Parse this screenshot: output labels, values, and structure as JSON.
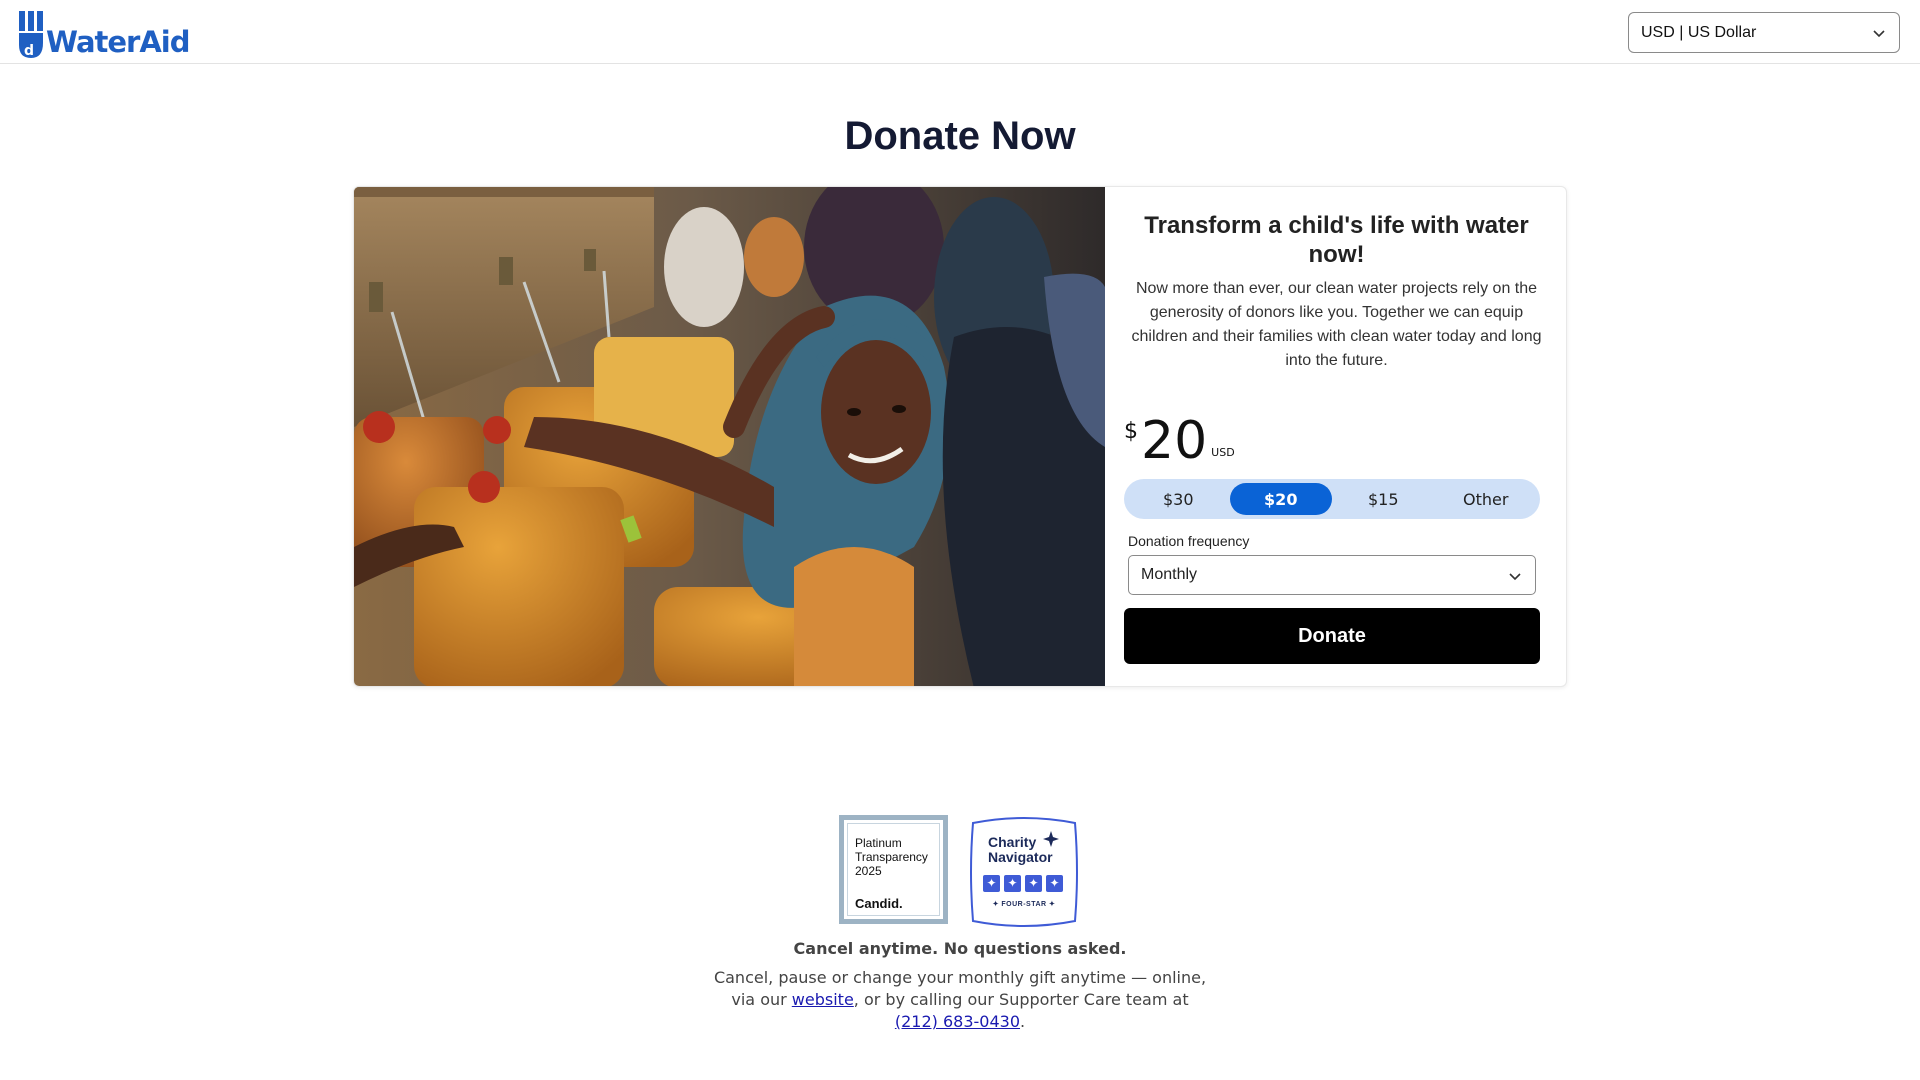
{
  "header": {
    "logo_text": "WaterAid",
    "currency_select_value": "USD | US Dollar",
    "brand_color": "#1f5fc2"
  },
  "page_title": "Donate Now",
  "photo": {
    "icon": "photo-children-water-taps"
  },
  "donation_panel": {
    "title": "Transform a child's life with water now!",
    "description": "Now more than ever, our clean water projects rely on the generosity of donors like you. Together we can equip children and their families with clean water today and long into the future.",
    "amount": {
      "currency_symbol": "$",
      "value": "20",
      "currency_code": "USD"
    },
    "amount_options": [
      {
        "label": "$30",
        "selected": false
      },
      {
        "label": "$20",
        "selected": true
      },
      {
        "label": "$15",
        "selected": false
      },
      {
        "label": "Other",
        "selected": false
      }
    ],
    "frequency_label": "Donation frequency",
    "frequency_value": "Monthly",
    "donate_button": "Donate",
    "accent_color": "#0a63d6"
  },
  "badges": {
    "candid": {
      "line1": "Platinum",
      "line2": "Transparency",
      "line3": "2025",
      "brand": "Candid."
    },
    "charity_navigator": {
      "line1": "Charity",
      "line2": "Navigator",
      "rating_label": "FOUR-STAR",
      "stars": 4
    }
  },
  "footer": {
    "cancel_heading": "Cancel anytime. No questions asked.",
    "cancel_text_1": "Cancel, pause or change your monthly gift anytime — online, via our ",
    "website_link": "website",
    "cancel_text_2": ", or by calling our Supporter Care team at ",
    "phone_link": "(212) 683-0430",
    "cancel_text_3": "."
  }
}
